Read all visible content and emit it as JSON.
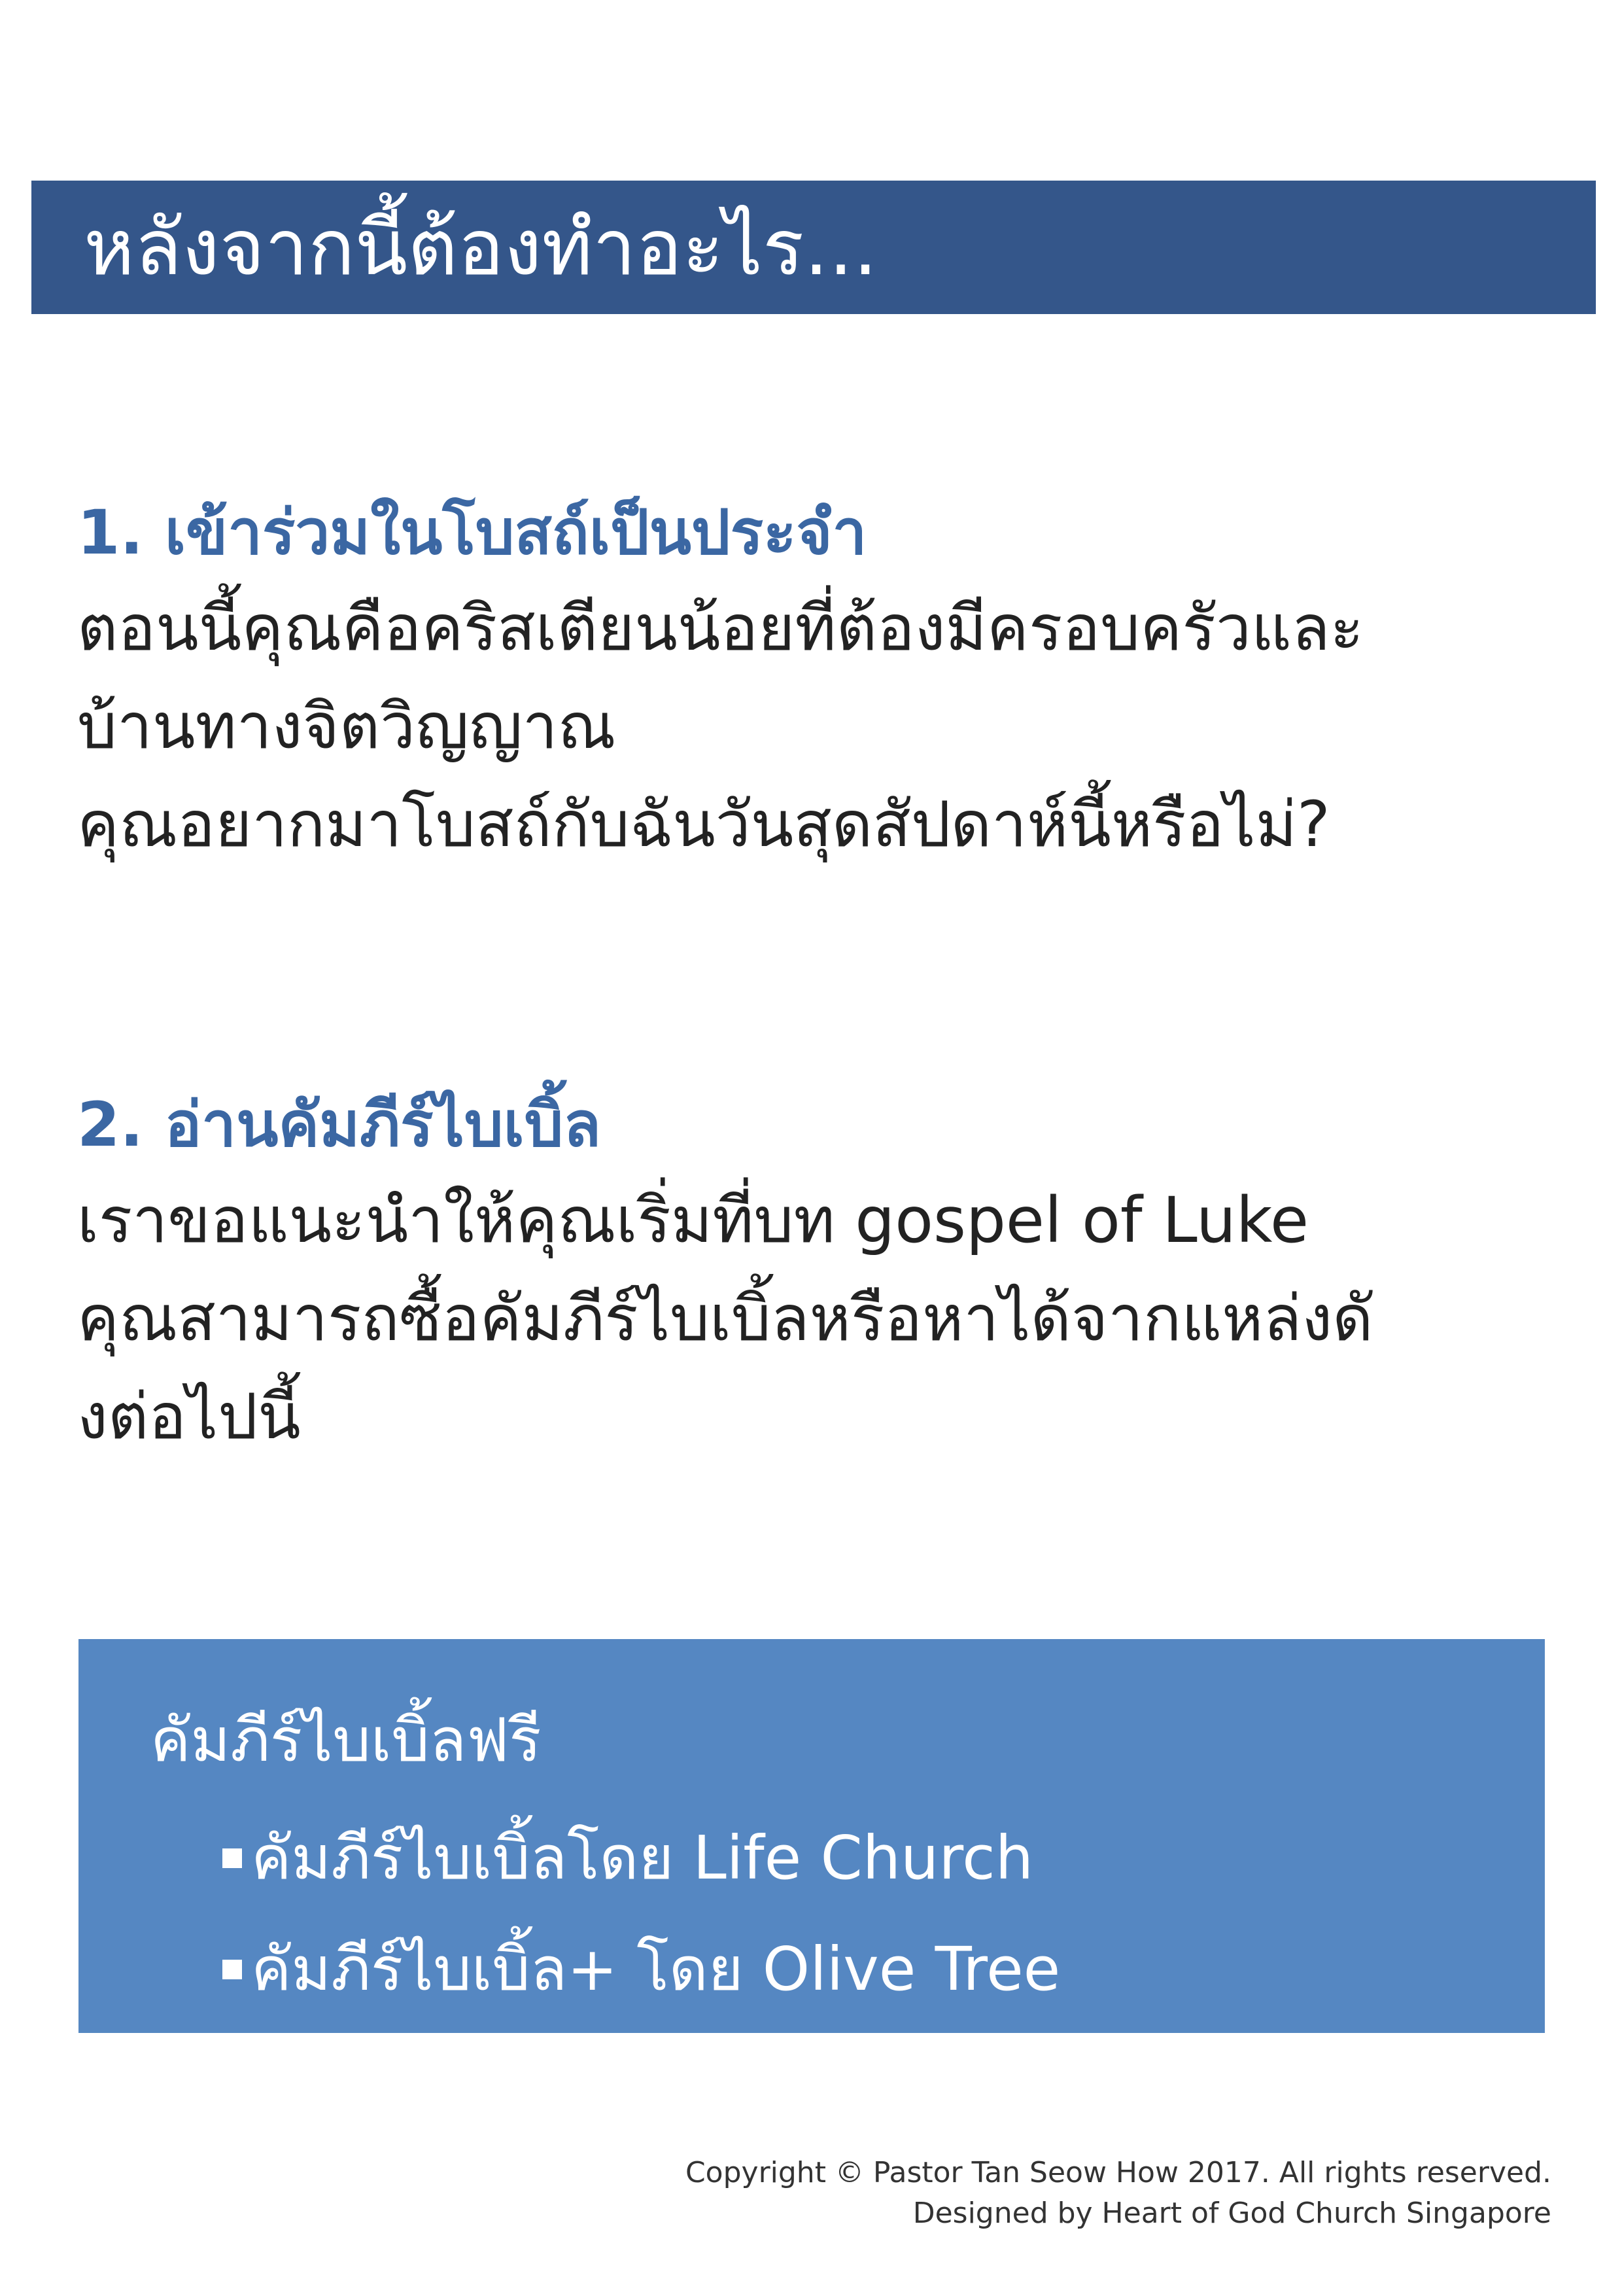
{
  "header": {
    "title": "หลังจากนี้ต้องทำอะไร..."
  },
  "sections": [
    {
      "heading": "1. เข้าร่วมในโบสถ์เป็นประจำ",
      "lines": [
        "ตอนนี้คุณคือคริสเตียนน้อยที่ต้องมีครอบครัวและ",
        "บ้านทางจิตวิญญาณ",
        "คุณอยากมาโบสถ์กับฉันวันสุดสัปดาห์นี้หรือไม่?"
      ]
    },
    {
      "heading": "2. อ่านคัมภีร์ไบเบิ้ล",
      "lines": [
        "เราขอแนะนำให้คุณเริ่มที่บท gospel of Luke",
        "คุณสามารถซื้อคัมภีร์ไบเบิ้ลหรือหาได้จากแหล่งดั",
        "งต่อไปนี้"
      ]
    }
  ],
  "resources": {
    "title": "คัมภีร์ไบเบิ้ลฟรี",
    "items": [
      {
        "label": "คัมภีร์ไบเบิ้ลโดย Life Church"
      },
      {
        "label": "คัมภีร์ไบเบิ้ล+ โดย Olive Tree"
      }
    ]
  },
  "footer": {
    "copyright": "Copyright © Pastor Tan Seow How 2017. All rights reserved.",
    "designed_by": "Designed by Heart of God Church Singapore"
  },
  "colors": {
    "header_bg": "#34568a",
    "heading_text": "#3b67a3",
    "resource_box_bg": "#5587c2"
  }
}
